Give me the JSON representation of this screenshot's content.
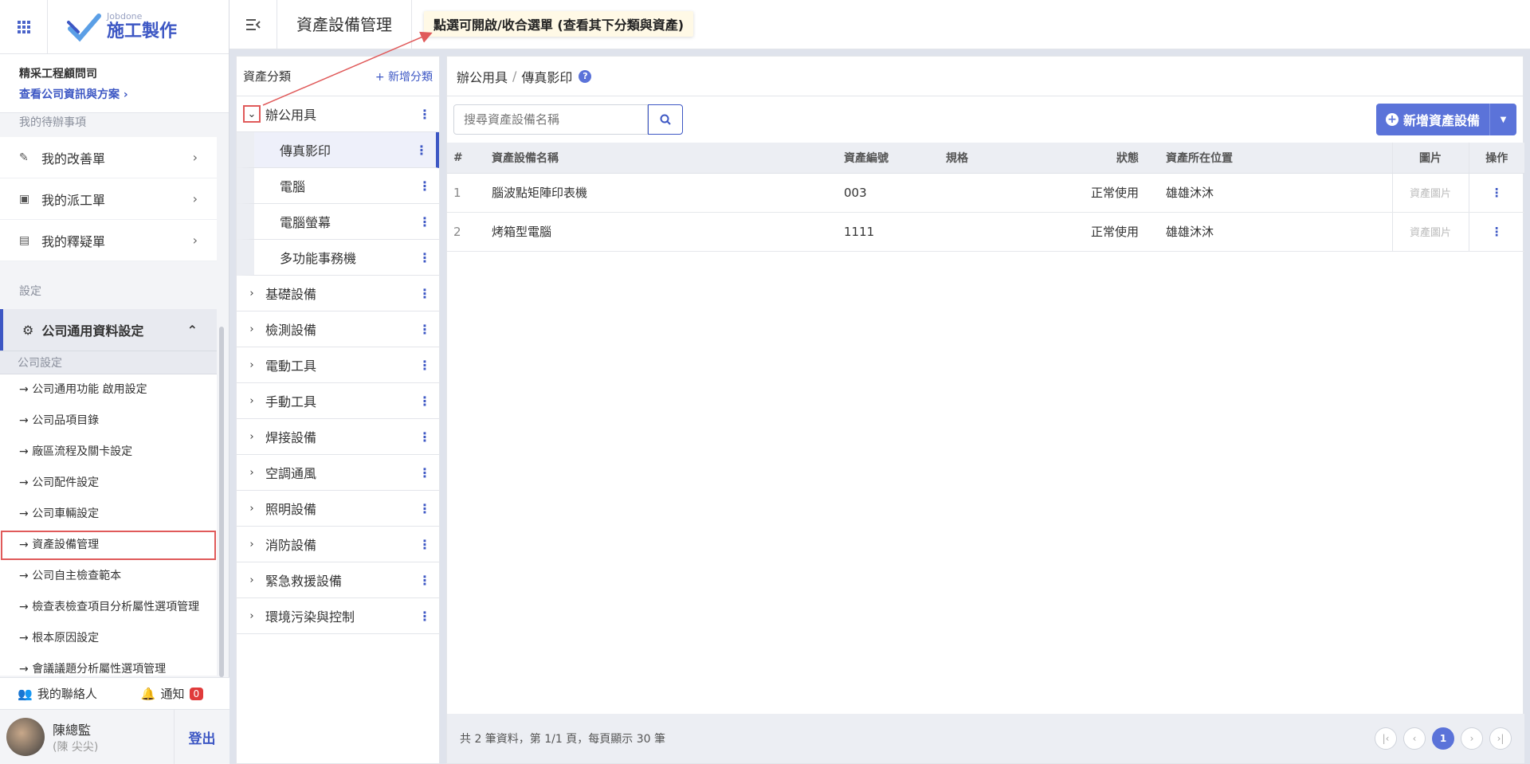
{
  "brand": {
    "sub": "Jobdone",
    "main": "施工製作"
  },
  "company": {
    "name": "精采工程顧問司",
    "link": "查看公司資訊與方案"
  },
  "sidebar": {
    "todo_label": "我的待辦事項",
    "todo_items": [
      {
        "label": "我的改善單",
        "icon": "edit-icon"
      },
      {
        "label": "我的派工單",
        "icon": "assignment-icon"
      },
      {
        "label": "我的釋疑單",
        "icon": "chat-icon"
      }
    ],
    "settings_label": "設定",
    "group_label": "公司通用資料設定",
    "sub_head": "公司設定",
    "sub_items": [
      "公司通用功能 啟用設定",
      "公司品項目錄",
      "廠區流程及關卡設定",
      "公司配件設定",
      "公司車輛設定",
      "資產設備管理",
      "公司自主檢查範本",
      "檢查表檢查項目分析屬性選項管理",
      "根本原因設定",
      "會議議題分析屬性選項管理"
    ],
    "active_sub": "資產設備管理"
  },
  "bottom": {
    "contacts": "我的聯絡人",
    "notify": "通知",
    "notify_count": "0"
  },
  "user": {
    "name": "陳總監",
    "sub": "(陳 尖尖)",
    "logout": "登出"
  },
  "header": {
    "title": "資產設備管理",
    "callout": "點選可開啟/收合選單 (查看其下分類與資產)"
  },
  "categories": {
    "title": "資產分類",
    "add_label": "+ 新增分類",
    "expanded": {
      "label": "辦公用具",
      "children": [
        "傳真影印",
        "電腦",
        "電腦螢幕",
        "多功能事務機"
      ]
    },
    "collapsed": [
      "基礎設備",
      "檢測設備",
      "電動工具",
      "手動工具",
      "焊接設備",
      "空調通風",
      "照明設備",
      "消防設備",
      "緊急救援設備",
      "環境污染與控制"
    ]
  },
  "main": {
    "crumb_parent": "辦公用具",
    "crumb_current": "傳真影印",
    "search_placeholder": "搜尋資產設備名稱",
    "add_label": "新增資產設備",
    "columns": {
      "num": "#",
      "name": "資產設備名稱",
      "code": "資產編號",
      "spec": "規格",
      "status": "狀態",
      "location": "資產所在位置",
      "image": "圖片",
      "action": "操作"
    },
    "rows": [
      {
        "num": "1",
        "name": "腦波點矩陣印表機",
        "code": "003",
        "spec": "",
        "status": "正常使用",
        "location": "雄雄沐沐",
        "image": "資產圖片"
      },
      {
        "num": "2",
        "name": "烤箱型電腦",
        "code": "1111",
        "spec": "",
        "status": "正常使用",
        "location": "雄雄沐沐",
        "image": "資產圖片"
      }
    ],
    "footer": "共 2 筆資料，第 1/1 頁，每頁顯示 30 筆",
    "page": "1"
  },
  "colors": {
    "accent": "#3d57c4",
    "highlight": "#e05a5a"
  }
}
